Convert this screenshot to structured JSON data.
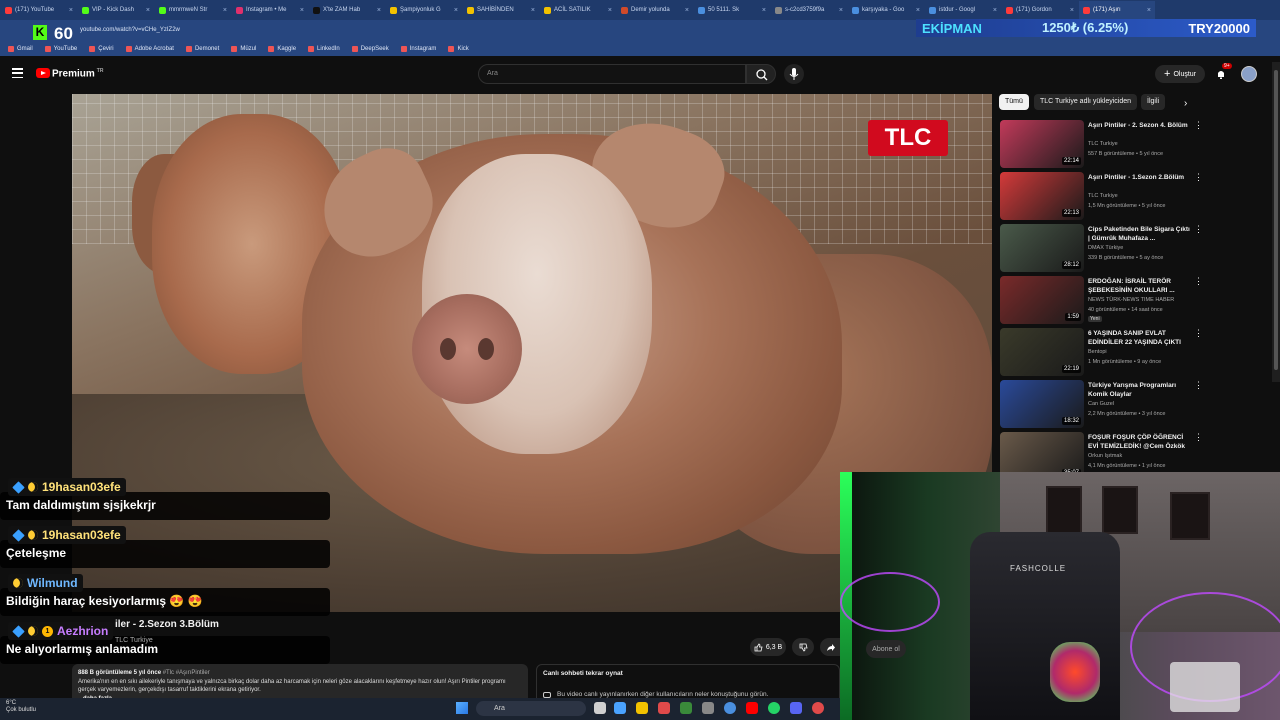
{
  "browser": {
    "tabs": [
      {
        "label": "(171) YouTube",
        "color": "#ff3b3b"
      },
      {
        "label": "VIP - Kick Dash",
        "color": "#53fc18"
      },
      {
        "label": "mmrmweN Str",
        "color": "#53fc18"
      },
      {
        "label": "Instagram • Me",
        "color": "#e1306c"
      },
      {
        "label": "X'te ZAM Hab",
        "color": "#111111"
      },
      {
        "label": "Şampiyonluk G",
        "color": "#f2c200"
      },
      {
        "label": "SAHİBİNDEN",
        "color": "#f2c200"
      },
      {
        "label": "ACİL SATILIK",
        "color": "#f2c200"
      },
      {
        "label": "Demir yolunda",
        "color": "#d04a2a"
      },
      {
        "label": "50 5111. Sk",
        "color": "#4a8fdf"
      },
      {
        "label": "s-c2cd3759f9a",
        "color": "#888888"
      },
      {
        "label": "karşıyaka - Goo",
        "color": "#4a8fdf"
      },
      {
        "label": "istdur - Googl",
        "color": "#4a8fdf"
      },
      {
        "label": "(171) Gordon",
        "color": "#ff3b3b"
      },
      {
        "label": "(171) Aşırı",
        "color": "#ff3b3b"
      }
    ],
    "kick_badge": "60",
    "url": "youtube.com/watch?v=vCHe_YzIZ2w",
    "ticker": {
      "left": "EKİPMAN",
      "mid": "1250₺ (6.25%)",
      "right": "TRY20000"
    },
    "bookmarks": [
      "Gmail",
      "YouTube",
      "Çeviri",
      "Adobe Acrobat",
      "Demonet",
      "Müzul",
      "Kaggle",
      "LinkedIn",
      "DeepSeek",
      "Instagram",
      "Kick"
    ]
  },
  "youtube": {
    "logo_text": "Premium",
    "logo_sup": "TR",
    "search_placeholder": "Ara",
    "create_label": "Oluştur",
    "notif_count": "9+"
  },
  "chips": [
    "Tümü",
    "TLC Turkiye adlı yükleyiciden",
    "İlgili"
  ],
  "related": [
    {
      "title": "Aşırı Pintiler - 2. Sezon 4. Bölüm",
      "channel": "TLC Turkiye",
      "meta": "557 B görüntüleme • 5 yıl önce",
      "duration": "22:14",
      "thumb": "#c23a5a",
      "badge": ""
    },
    {
      "title": "Aşırı Pintiler - 1.Sezon 2.Bölüm",
      "channel": "TLC Turkiye",
      "meta": "1,5 Mn görüntüleme • 5 yıl önce",
      "duration": "22:13",
      "thumb": "#d43a3a",
      "badge": ""
    },
    {
      "title": "Cips Paketinden Bile Sigara Çıktı | Gümrük Muhafaza ...",
      "channel": "DMAX Türkiye",
      "meta": "339 B görüntüleme • 5 ay önce",
      "duration": "28:12",
      "thumb": "#4a5a4a",
      "badge": ""
    },
    {
      "title": "ERDOĞAN: İSRAİL TERÖR ŞEBEKESİNİN OKULLARI ...",
      "channel": "NEWS TÜRK-NEWS TIME HABER",
      "meta": "40 görüntüleme • 14 saat önce",
      "duration": "1:59",
      "thumb": "#7a2a2a",
      "badge": "Yeni"
    },
    {
      "title": "6 YAŞINDA SANIP EVLAT EDİNDİLER 22 YAŞINDA ÇIKTI",
      "channel": "Bentopi",
      "meta": "1 Mn görüntüleme • 9 ay önce",
      "duration": "22:19",
      "thumb": "#3a3a2a",
      "badge": ""
    },
    {
      "title": "Türkiye Yarışma Programları Komik Olaylar",
      "channel": "Can Guzel",
      "meta": "2,2 Mn görüntüleme • 3 yıl önce",
      "duration": "18:32",
      "thumb": "#2a4a9a",
      "badge": ""
    },
    {
      "title": "FOŞUR FOŞUR ÇÖP ÖĞRENCİ EVİ TEMİZLEDİK! @Cem Özkök",
      "channel": "Orkun Işıtmak",
      "meta": "4,1 Mn görüntüleme • 1 yıl önce",
      "duration": "35:07",
      "thumb": "#6a5a4a",
      "badge": ""
    }
  ],
  "video": {
    "watermark": "TLC",
    "title_fragment": "iler - 2.Sezon 3.Bölüm",
    "channel_fragment": "TLC Turkiye",
    "subscribe": "Abone ol",
    "likes": "6,3 B"
  },
  "chat": [
    {
      "user": "19hasan03efe",
      "user_color": "#ffe27a",
      "message": "Tam daldımıştım sjsjkekrjr"
    },
    {
      "user": "19hasan03efe",
      "user_color": "#ffe27a",
      "message": "Çeteleşme"
    },
    {
      "user": "Wilmund",
      "user_color": "#6fb8ff",
      "message": "Bildiğin haraç kesiyorlarmış 😍 😍"
    },
    {
      "user": "Aezhrion",
      "user_color": "#c77dff",
      "message": "Ne alıyorlarmış anlamadım"
    }
  ],
  "description": {
    "views": "888 B görüntüleme  5 yıl önce",
    "tags": "#Tlc #AşırıPintiler",
    "text": "Amerika'nın en en sıkı ailekeriyle tanışmaya ve yalnızca birkaç dolar daha az harcamak için neleri göze alacaklarını keşfetmeye hazır olun! Aşırı Pintiler programı gerçek varyemezlerin, gerçekdışı tasarruf taktiklerini ekrana getiriyor.",
    "more": "...daha fazla"
  },
  "live_chat_replay": {
    "title": "Canlı sohbeti tekrar oynat",
    "body": "Bu video canlı yayınlanırken diğer kullanıcıların neler konuştuğunu görün."
  },
  "webcam": {
    "chair_brand": "FASHCOLLE"
  },
  "taskbar": {
    "weather_temp": "6°C",
    "weather_desc": "Çok bulutlu",
    "search": "Ara"
  }
}
